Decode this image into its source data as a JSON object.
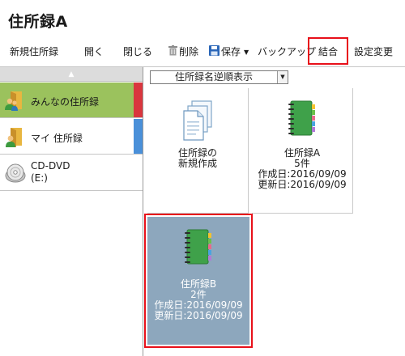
{
  "window": {
    "title": "住所録A"
  },
  "toolbar": {
    "new_label": "新規住所録",
    "open_label": "開く",
    "close_label": "閉じる",
    "delete_label": "削除",
    "save_label": "保存",
    "backup_label": "バックアップ",
    "merge_label": "結合",
    "settings_label": "設定変更"
  },
  "sidebar": {
    "scroll_up": "▲",
    "items": [
      {
        "label": "みんなの住所録",
        "selected": true,
        "accent": "#d9363e",
        "icon": "shared-addressbook-icon"
      },
      {
        "label": "マイ 住所録",
        "selected": false,
        "accent": "#4a90d9",
        "icon": "my-addressbook-icon"
      },
      {
        "label_line1": "CD-DVD",
        "label_line2": "(E:)",
        "selected": false,
        "icon": "cd-dvd-icon"
      }
    ]
  },
  "main": {
    "sort": {
      "value": "住所録名逆順表示"
    },
    "cards": [
      {
        "name": "新規作成",
        "line1": "住所録の",
        "line2": "新規作成",
        "icon": "new-addressbook-icon"
      },
      {
        "name": "住所録A",
        "line1": "住所録A",
        "line2": "5件",
        "line3": "作成日:2016/09/09",
        "line4": "更新日:2016/09/09",
        "icon": "addressbook-icon"
      },
      {
        "name": "住所録B",
        "line1": "住所録B",
        "line2": "2件",
        "line3": "作成日:2016/09/09",
        "line4": "更新日:2016/09/09",
        "icon": "addressbook-icon",
        "selected": true
      }
    ]
  },
  "colors": {
    "selected_sidebar": "#9bc25d",
    "selected_card": "#8da7bd",
    "highlight": "#e8101a",
    "book_green": "#3fa14a"
  }
}
